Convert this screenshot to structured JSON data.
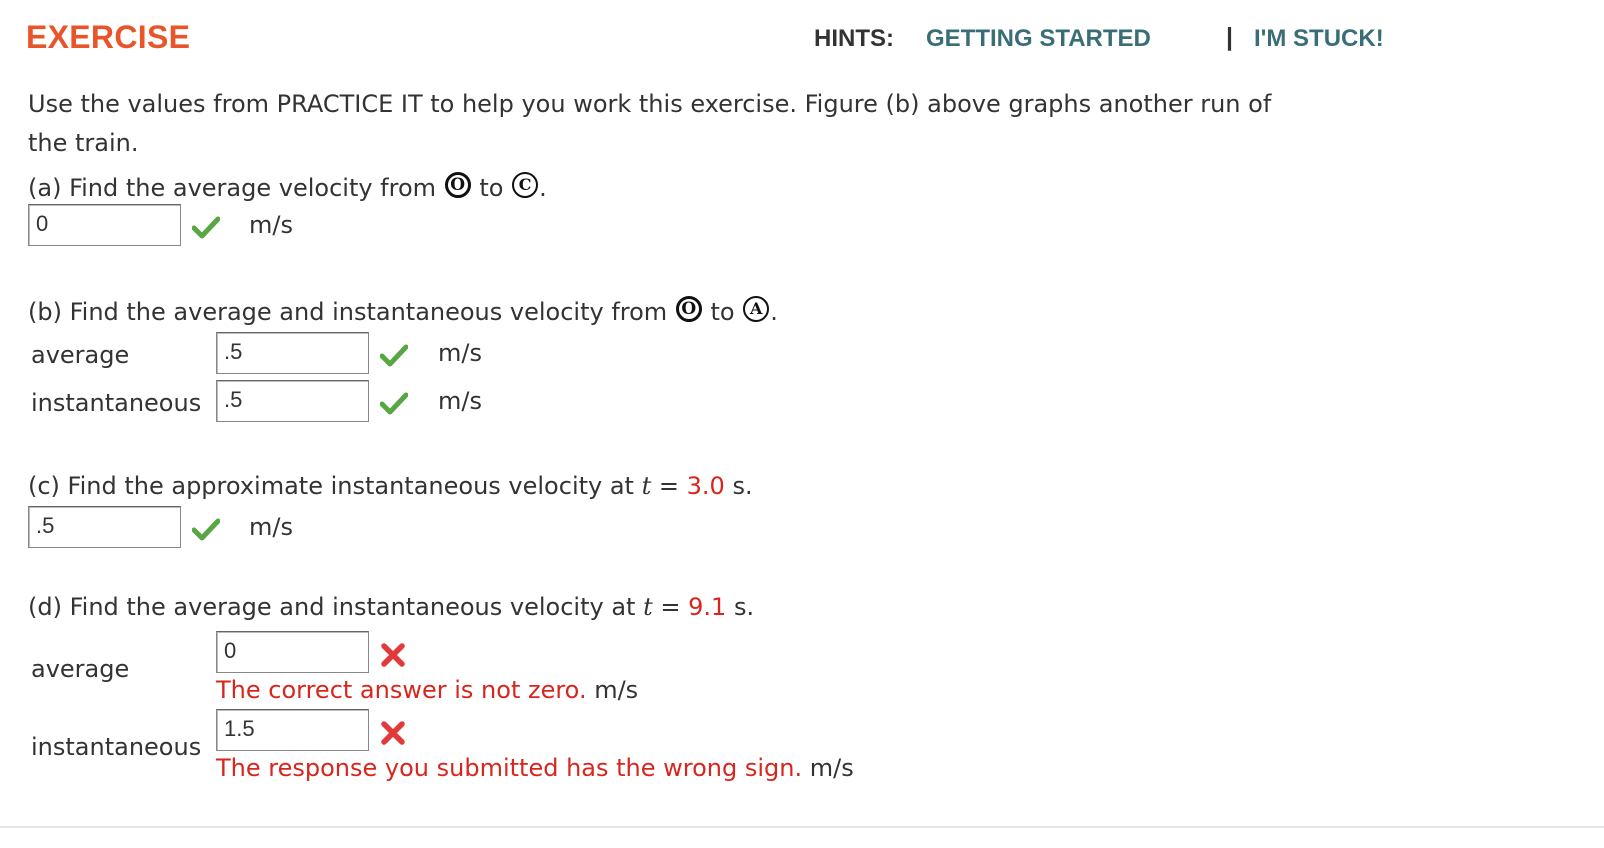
{
  "header": {
    "title": "EXERCISE",
    "hints_label": "HINTS:",
    "hint_getting_started": "GETTING STARTED",
    "separator": "|",
    "hint_stuck": "I'M STUCK!"
  },
  "intro": {
    "line1": "Use the values from PRACTICE IT to help you work this exercise. Figure (b) above graphs another run of",
    "line2": "the train."
  },
  "symbols": {
    "O": "O",
    "A": "A",
    "C": "C"
  },
  "part_a": {
    "prompt_prefix": "(a) Find the average velocity from",
    "to": "to",
    "period": ".",
    "answer": "0",
    "unit": "m/s"
  },
  "part_b": {
    "prompt_prefix": "(b) Find the average and instantaneous velocity from",
    "to": "to",
    "period": ".",
    "average_label": "average",
    "average_answer": ".5",
    "average_unit": "m/s",
    "instant_label": "instantaneous",
    "instant_answer": ".5",
    "instant_unit": "m/s"
  },
  "part_c": {
    "prompt_prefix": "(c) Find the approximate instantaneous velocity at",
    "var": "t",
    "equals": "=",
    "value": "3.0",
    "unit_s": "s.",
    "answer": ".5",
    "unit": "m/s"
  },
  "part_d": {
    "prompt_prefix": "(d) Find the average and instantaneous velocity at",
    "var": "t",
    "equals": "=",
    "value": "9.1",
    "unit_s": "s.",
    "average_label": "average",
    "average_answer": "0",
    "average_feedback": "The correct answer is not zero.",
    "average_unit": "m/s",
    "instant_label": "instantaneous",
    "instant_answer": "1.5",
    "instant_feedback": "The response you submitted has the wrong sign.",
    "instant_unit": "m/s"
  },
  "colors": {
    "title": "#e8552a",
    "hint_link": "#3a6e77",
    "error": "#d8261e",
    "check": "#5aa544",
    "x": "#e23a3a"
  },
  "icons": {
    "correct": "check-icon",
    "incorrect": "x-icon"
  }
}
